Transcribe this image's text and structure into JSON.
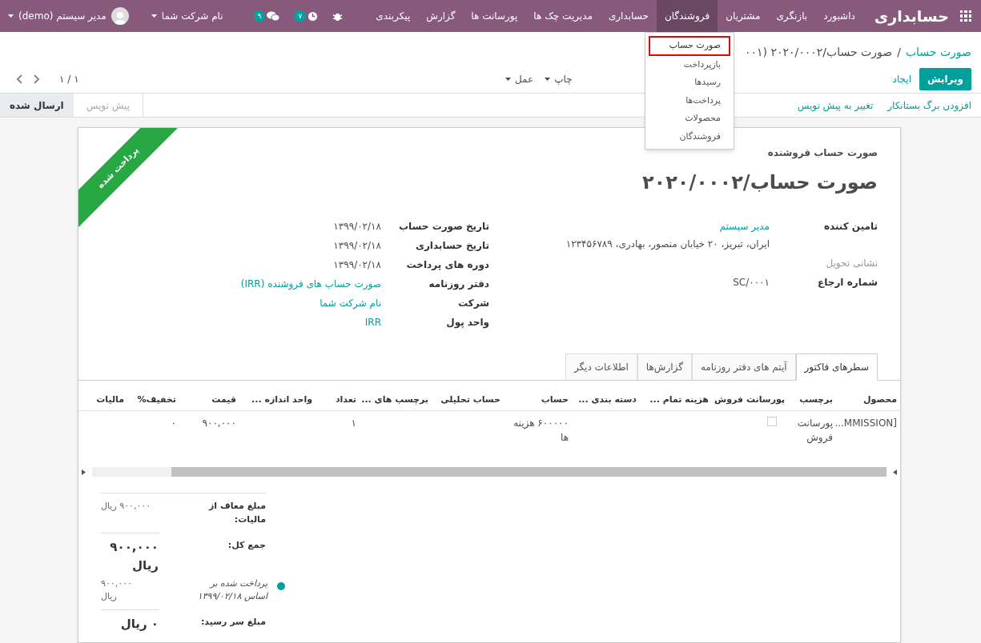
{
  "navbar": {
    "brand": "حسابداری",
    "menu": [
      {
        "label": "داشبورد",
        "selected": false
      },
      {
        "label": "بازنگری",
        "selected": false
      },
      {
        "label": "مشتریان",
        "selected": false
      },
      {
        "label": "فروشندگان",
        "selected": true
      },
      {
        "label": "حسابداری",
        "selected": false
      },
      {
        "label": "مدیریت چک ها",
        "selected": false
      },
      {
        "label": "پورسانت ها",
        "selected": false
      },
      {
        "label": "گزارش",
        "selected": false
      },
      {
        "label": "پیکربندی",
        "selected": false
      }
    ],
    "activity_badge": "۷",
    "messages_badge": "۹",
    "company": "نام شرکت شما",
    "user": "مدیر سیستم (demo)"
  },
  "dropdown": {
    "items": [
      {
        "label": "صورت حساب",
        "selected": true
      },
      {
        "label": "بازپرداخت",
        "selected": false
      },
      {
        "label": "رسیدها",
        "selected": false
      },
      {
        "label": "پرداخت‌ها",
        "selected": false
      },
      {
        "label": "محصولات",
        "selected": false
      },
      {
        "label": "فروشندگان",
        "selected": false
      }
    ]
  },
  "breadcrumb": {
    "parent": "صورت حساب",
    "separator": "/",
    "current": "صورت حساب/۲۰۲۰/۰۰۰۲ (۰۰۱"
  },
  "buttons": {
    "edit": "ویرایش",
    "create": "ایجاد",
    "print": "چاپ",
    "action": "عمل"
  },
  "pager": "۱ / ۱",
  "statusbar": {
    "actions": [
      "افزودن برگ بستانکار",
      "تغییر به پیش نویس"
    ],
    "stages": [
      {
        "label": "پیش نویس",
        "selected": false
      },
      {
        "label": "ارسال شده",
        "selected": true
      }
    ]
  },
  "sheet": {
    "ribbon": "پرداخت شده",
    "subtitle": "صورت حساب فروشنده",
    "title": "صورت حساب/۲۰۲۰/۰۰۰۲",
    "groups": [
      [
        {
          "label": "تامین کننده",
          "value": "مدیر سیستم",
          "kind": "link",
          "address": "ایران، تبریز، ۲۰ خیابان منصور، بهادری، ۱۲۳۴۵۶۷۸۹"
        },
        {
          "label": "نشانی تحویل",
          "kind": "muted"
        },
        {
          "label": "شماره ارجاع",
          "value": "SC/۰۰۰۱",
          "kind": "text"
        }
      ],
      [
        {
          "label": "تاریخ صورت حساب",
          "value": "۱۳۹۹/۰۲/۱۸",
          "kind": "text"
        },
        {
          "label": "تاریخ حسابداری",
          "value": "۱۳۹۹/۰۲/۱۸",
          "kind": "text"
        },
        {
          "label": "دوره های پرداخت",
          "value": "۱۳۹۹/۰۲/۱۸",
          "kind": "text"
        },
        {
          "label": "دفتر روزنامه",
          "value": "صورت حساب های فروشنده (IRR)",
          "kind": "link"
        },
        {
          "label": "شرکت",
          "value": "نام شرکت شما",
          "kind": "link"
        },
        {
          "label": "واحد پول",
          "value": "IRR",
          "kind": "link"
        }
      ]
    ],
    "tabs": [
      {
        "label": "سطرهای فاکتور",
        "selected": true
      },
      {
        "label": "آیتم های دفتر روزنامه",
        "selected": false
      },
      {
        "label": "گزارش‌ها",
        "selected": false
      },
      {
        "label": "اطلاعات دیگر",
        "selected": false
      }
    ],
    "table": {
      "columns": [
        "محصول",
        "برچسب",
        "پورسانت فروش",
        "هزینه تمام ...",
        "دسته بندی ...",
        "حساب",
        "حساب تحلیلی",
        "برچسب های ...",
        "تعداد",
        "واحد اندازه ...",
        "قیمت",
        "تخفیف%",
        "مالیات"
      ],
      "rows": [
        {
          "cells": [
            {
              "kind": "text",
              "text": "[MMISSION..."
            },
            {
              "kind": "text",
              "text": "پورسانت فروش"
            },
            {
              "kind": "checkbox",
              "checked": false
            },
            {
              "kind": "empty"
            },
            {
              "kind": "empty"
            },
            {
              "kind": "text",
              "text": "۶۰۰۰۰۰ هزینه ها"
            },
            {
              "kind": "empty"
            },
            {
              "kind": "empty"
            },
            {
              "kind": "text",
              "text": "۱"
            },
            {
              "kind": "empty"
            },
            {
              "kind": "text",
              "text": "۹۰۰,۰۰۰"
            },
            {
              "kind": "text",
              "text": "۰"
            },
            {
              "kind": "empty"
            }
          ]
        }
      ]
    },
    "totals": [
      {
        "label": "مبلغ معاف از مالیات:",
        "value": "۹۰۰,۰۰۰ ریال",
        "kind": "small"
      },
      {
        "label": "جمع کل:",
        "value": "۹۰۰,۰۰۰ ریال",
        "kind": "big"
      },
      {
        "kind": "payment",
        "text": "پرداخت شده بر اساس ۱۳۹۹/۰۲/۱۸",
        "value": "۹۰۰,۰۰۰ ریال"
      },
      {
        "label": "مبلغ سر رسید:",
        "value": "۰ ریال",
        "kind": "big"
      }
    ]
  }
}
